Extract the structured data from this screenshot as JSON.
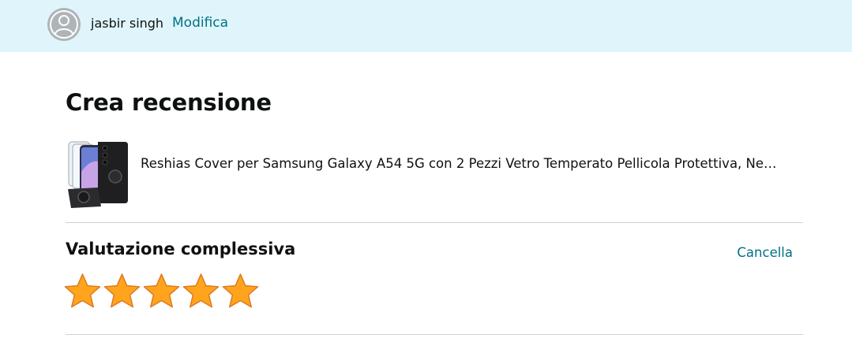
{
  "header": {
    "user_name": "jasbir singh",
    "edit_label": "Modifica"
  },
  "page": {
    "title": "Crea recensione"
  },
  "product": {
    "name": "Reshias Cover per Samsung Galaxy A54 5G con 2 Pezzi Vetro Temperato Pellicola Protettiva, Ne…"
  },
  "rating": {
    "heading": "Valutazione complessiva",
    "clear_label": "Cancella",
    "value": 5,
    "max": 5
  },
  "colors": {
    "header_bg": "#dff5fb",
    "link": "#007185",
    "star_fill": "#ffa41c",
    "star_stroke": "#de7921"
  }
}
